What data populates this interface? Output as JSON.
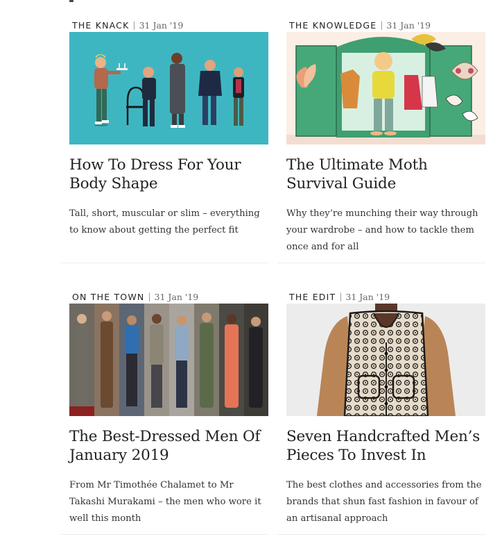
{
  "articles": [
    {
      "category": "THE KNACK",
      "date": "31 Jan '19",
      "title": "How To Dress For Your Body Shape",
      "description": "Tall, short, muscular or slim – everything to know about getting the perfect fit",
      "image": "illustration-men-different-body-shapes"
    },
    {
      "category": "THE KNOWLEDGE",
      "date": "31 Jan '19",
      "title": "The Ultimate Moth Survival Guide",
      "description": "Why they’re munching their way through your wardrobe – and how to tackle them once and for all",
      "image": "illustration-moths-in-wardrobe"
    },
    {
      "category": "ON THE TOWN",
      "date": "31 Jan '19",
      "title": "The Best-Dressed Men Of January 2019",
      "description": "From Mr Timothée Chalamet to Mr Takashi Murakami – the men who wore it well this month",
      "image": "photo-collage-best-dressed-men"
    },
    {
      "category": "THE EDIT",
      "date": "31 Jan '19",
      "title": "Seven Handcrafted Men’s Pieces To Invest In",
      "description": "The best clothes and accessories from the brands that shun fast fashion in favour of an artisanal approach",
      "image": "photo-crochet-vest-on-model"
    }
  ],
  "separator": "|",
  "colors": {
    "text": "#222222",
    "muted": "#666666",
    "teal_background": "#3eb6c1",
    "wardrobe_green": "#3f9f70",
    "rule": "#ececec"
  }
}
